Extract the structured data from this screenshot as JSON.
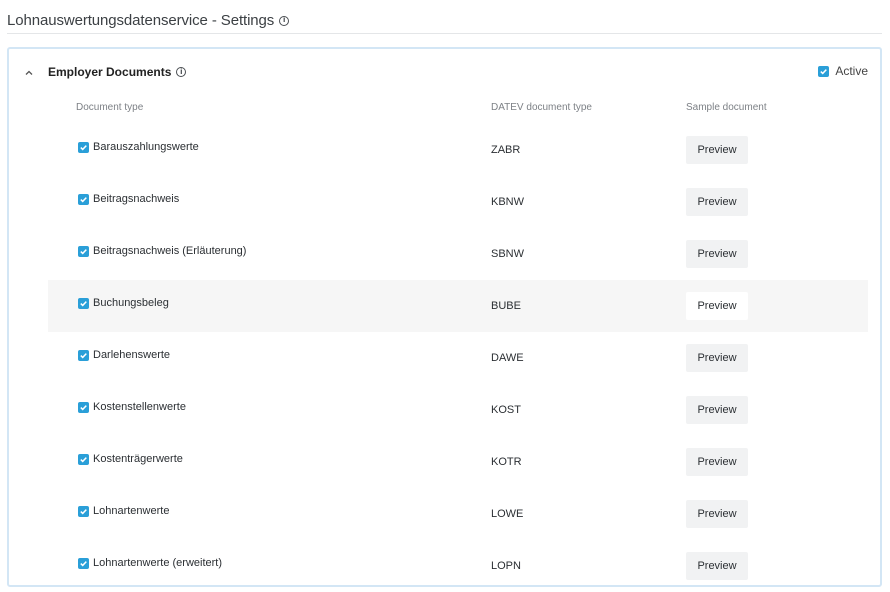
{
  "header": {
    "title": "Lohnauswertungsdatenservice - Settings",
    "info_icon": "info-icon"
  },
  "panel": {
    "title": "Employer Documents",
    "expanded": true,
    "active_label": "Active",
    "active_checked": true,
    "columns": {
      "document_type": "Document type",
      "datev_type": "DATEV document type",
      "sample": "Sample document"
    },
    "preview_label": "Preview",
    "checkbox_color": "#2a9fd8",
    "rows": [
      {
        "name": "Barauszahlungswerte",
        "code": "ZABR",
        "checked": true
      },
      {
        "name": "Beitragsnachweis",
        "code": "KBNW",
        "checked": true
      },
      {
        "name": "Beitragsnachweis (Erläuterung)",
        "code": "SBNW",
        "checked": true
      },
      {
        "name": "Buchungsbeleg",
        "code": "BUBE",
        "checked": true,
        "highlighted": true
      },
      {
        "name": "Darlehenswerte",
        "code": "DAWE",
        "checked": true
      },
      {
        "name": "Kostenstellenwerte",
        "code": "KOST",
        "checked": true
      },
      {
        "name": "Kostenträgerwerte",
        "code": "KOTR",
        "checked": true
      },
      {
        "name": "Lohnartenwerte",
        "code": "LOWE",
        "checked": true
      },
      {
        "name": "Lohnartenwerte (erweitert)",
        "code": "LOPN",
        "checked": true
      }
    ]
  }
}
